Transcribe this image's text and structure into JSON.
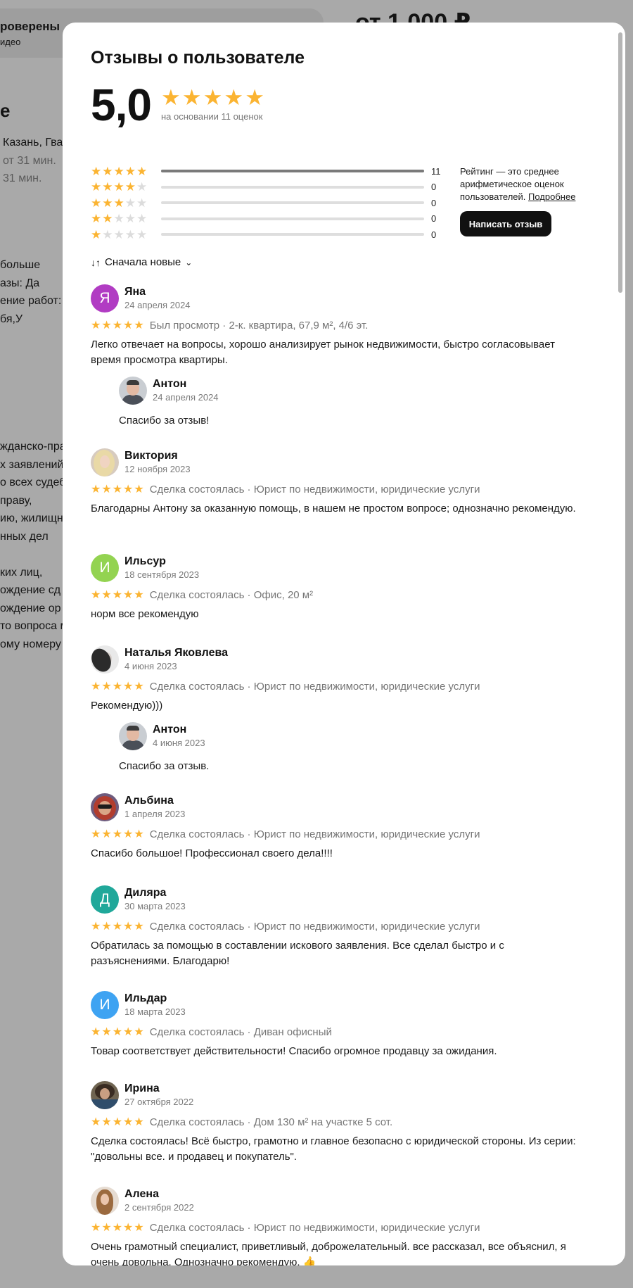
{
  "background": {
    "verified_title": "роверены",
    "verified_sub": "идео",
    "price": "от 1 000 ₽",
    "heading_fragment": "е",
    "lines": [
      {
        "text": "Казань, Гва",
        "grey": false
      },
      {
        "text": "от 31 мин.",
        "grey": true
      },
      {
        "text": "31 мин.",
        "grey": true
      }
    ],
    "block2": [
      {
        "text": "больше",
        "grey": false
      },
      {
        "text": "азы: Да",
        "grey": false
      },
      {
        "text": "ение работ: Да",
        "grey": false
      },
      {
        "text": "бя,У",
        "grey": false
      }
    ],
    "block3": [
      "жданско-пра",
      "х заявлений,",
      "о всех судеб",
      "праву,",
      "ию, жилищно",
      "нных дел",
      "",
      "ких лиц,",
      "ождение сд",
      "ождение ор",
      "то вопроса м",
      "ому номеру"
    ]
  },
  "modal": {
    "title": "Отзывы о пользователе",
    "rating_value": "5,0",
    "rating_stars": 5,
    "based_on": "на основании 11 оценок",
    "distribution": [
      {
        "stars": 5,
        "count": "11",
        "fraction": 1.0
      },
      {
        "stars": 4,
        "count": "0",
        "fraction": 0
      },
      {
        "stars": 3,
        "count": "0",
        "fraction": 0
      },
      {
        "stars": 2,
        "count": "0",
        "fraction": 0
      },
      {
        "stars": 1,
        "count": "0",
        "fraction": 0
      }
    ],
    "rating_info": "Рейтинг — это среднее арифметическое оценок пользователей.",
    "rating_info_link": "Подробнее",
    "write_review": "Написать отзыв",
    "sort_label": "Сначала новые",
    "colors": {
      "star": "#fbb432",
      "button": "#111111"
    }
  },
  "reviews": [
    {
      "name": "Яна",
      "date": "24 апреля 2024",
      "avatar_letter": "Я",
      "avatar_color": "#b13cc3",
      "meta": "Был просмотр · 2-к. квартира, 67,9 м², 4/6 эт.",
      "text": "Легко отвечает на вопросы, хорошо анализирует рынок недвижимости, быстро согласовывает время просмотра квартиры.",
      "reply": {
        "name": "Антон",
        "date": "24 апреля 2024",
        "text": "Спасибо за отзыв!"
      }
    },
    {
      "name": "Виктория",
      "date": "12 ноября 2023",
      "avatar_photo": "viktoria",
      "meta": "Сделка состоялась · Юрист по недвижимости, юридические услуги",
      "text": "Благодарны Антону за оказанную помощь, в нашем не простом вопросе; однозначно рекомендую."
    },
    {
      "name": "Ильсур",
      "date": "18 сентября 2023",
      "avatar_letter": "И",
      "avatar_color": "#93d351",
      "meta": "Сделка состоялась · Офис, 20 м²",
      "text": "норм все рекомендую"
    },
    {
      "name": "Наталья Яковлева",
      "date": "4 июня 2023",
      "avatar_photo": "natalia",
      "meta": "Сделка состоялась · Юрист по недвижимости, юридические услуги",
      "text": "Рекомендую)))",
      "reply": {
        "name": "Антон",
        "date": "4 июня 2023",
        "text": "Спасибо за отзыв."
      }
    },
    {
      "name": "Альбина",
      "date": "1 апреля 2023",
      "avatar_photo": "albina",
      "meta": "Сделка состоялась · Юрист по недвижимости, юридические услуги",
      "text": "Спасибо большое! Профессионал своего дела!!!!"
    },
    {
      "name": "Диляра",
      "date": "30 марта 2023",
      "avatar_letter": "Д",
      "avatar_color": "#20a89a",
      "meta": "Сделка состоялась · Юрист по недвижимости, юридические услуги",
      "text": "Обратилась за помощью в составлении искового заявления. Все сделал быстро и с разъяснениями. Благодарю!"
    },
    {
      "name": "Ильдар",
      "date": "18 марта 2023",
      "avatar_letter": "И",
      "avatar_color": "#3ea3f2",
      "meta": "Сделка состоялась · Диван офисный",
      "text": "Товар соответствует действительности! Спасибо огромное продавцу за ожидания."
    },
    {
      "name": "Ирина",
      "date": "27 октября 2022",
      "avatar_photo": "irina",
      "meta": "Сделка состоялась · Дом 130 м² на участке 5 сот.",
      "text": "Сделка состоялась! Всё быстро, грамотно и главное безопасно с юридической стороны. Из серии: \"довольны все. и продавец и покупатель\"."
    },
    {
      "name": "Алена",
      "date": "2 сентября 2022",
      "avatar_photo": "alena",
      "meta": "Сделка состоялась · Юрист по недвижимости, юридические услуги",
      "text": "Очень грамотный специалист, приветливый, доброжелательный. все рассказал, все объяснил, я очень довольна. Однозначно рекомендую. 👍"
    }
  ]
}
